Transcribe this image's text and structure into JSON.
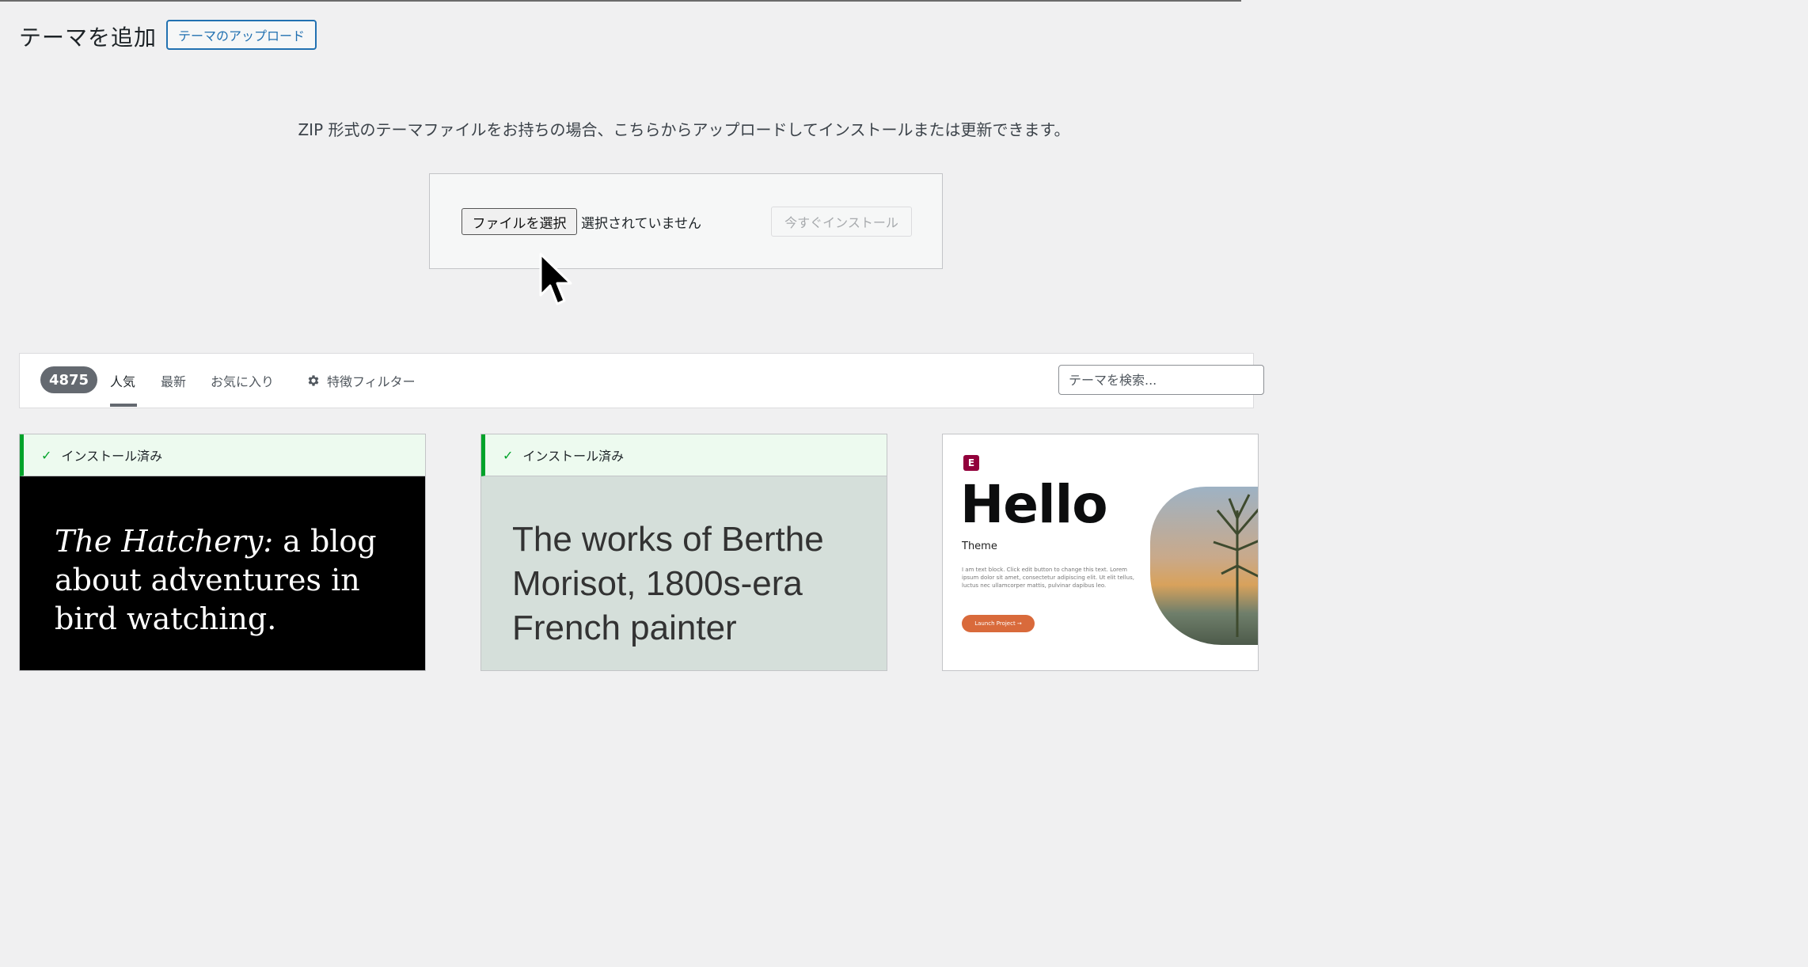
{
  "header": {
    "title": "テーマを追加",
    "upload_button": "テーマのアップロード"
  },
  "upload": {
    "help_text": "ZIP 形式のテーマファイルをお持ちの場合、こちらからアップロードしてインストールまたは更新できます。",
    "choose_file_button": "ファイルを選択",
    "file_status": "選択されていません",
    "install_button": "今すぐインストール"
  },
  "filter_bar": {
    "count": "4875",
    "tabs": [
      {
        "label": "人気",
        "active": true
      },
      {
        "label": "最新",
        "active": false
      },
      {
        "label": "お気に入り",
        "active": false
      }
    ],
    "feature_filter": "特徴フィルター",
    "search_placeholder": "テーマを検索..."
  },
  "themes": [
    {
      "installed_label": "インストール済み",
      "preview_text_italic": "The Hatchery:",
      "preview_text_rest": " a blog about adventures in bird watching."
    },
    {
      "installed_label": "インストール済み",
      "preview_text": "The works of Berthe Morisot, 1800s-era French painter"
    },
    {
      "preview_logo": "E",
      "preview_title": "Hello",
      "preview_subtitle": "Theme",
      "preview_body": "I am text block. Click edit button to change this text. Lorem ipsum dolor sit amet, consectetur adipiscing elit. Ut elit tellus, luctus nec ullamcorper mattis, pulvinar dapibus leo.",
      "preview_button": "Launch Project →"
    }
  ],
  "colors": {
    "accent": "#2271b1",
    "installed_green": "#00a32a",
    "badge_gray": "#646970"
  }
}
